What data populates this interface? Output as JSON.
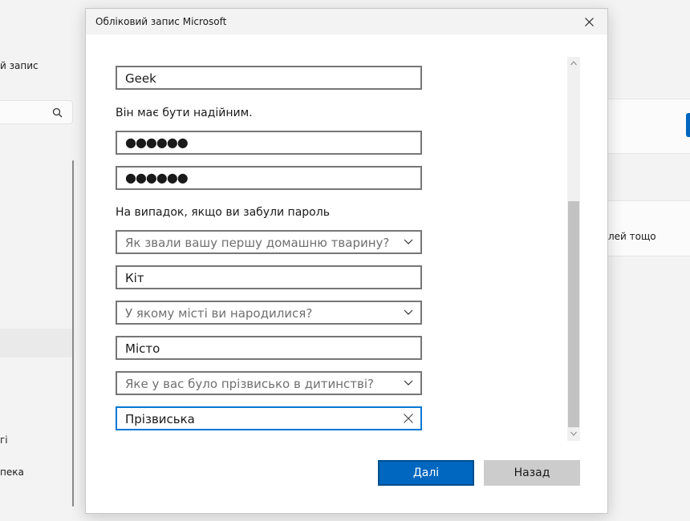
{
  "background": {
    "account_label": "й запис",
    "notify_text": "лей тощо",
    "item_1": "гі",
    "item_2": "пека"
  },
  "dialog": {
    "title": "Обліковий запис Microsoft",
    "name_value": "Geek",
    "password_hint": "Він має бути надійним.",
    "password_value": "●●●●●●",
    "confirm_password_value": "●●●●●●",
    "security_heading": "На випадок, якщо ви забули пароль",
    "question_1": "Як звали вашу першу домашню тварину?",
    "answer_1": "Кіт",
    "question_2": "У якому місті ви народилися?",
    "answer_2": "Місто",
    "question_3": "Яке у вас було прізвисько в дитинстві?",
    "answer_3": "Прізвиська",
    "next_label": "Далі",
    "back_label": "Назад"
  },
  "colors": {
    "accent": "#0067c0",
    "focus_border": "#0078d4"
  },
  "icons": {
    "close": "close-icon",
    "search": "search-icon",
    "chevron": "chevron-down-icon",
    "clear": "clear-icon"
  }
}
